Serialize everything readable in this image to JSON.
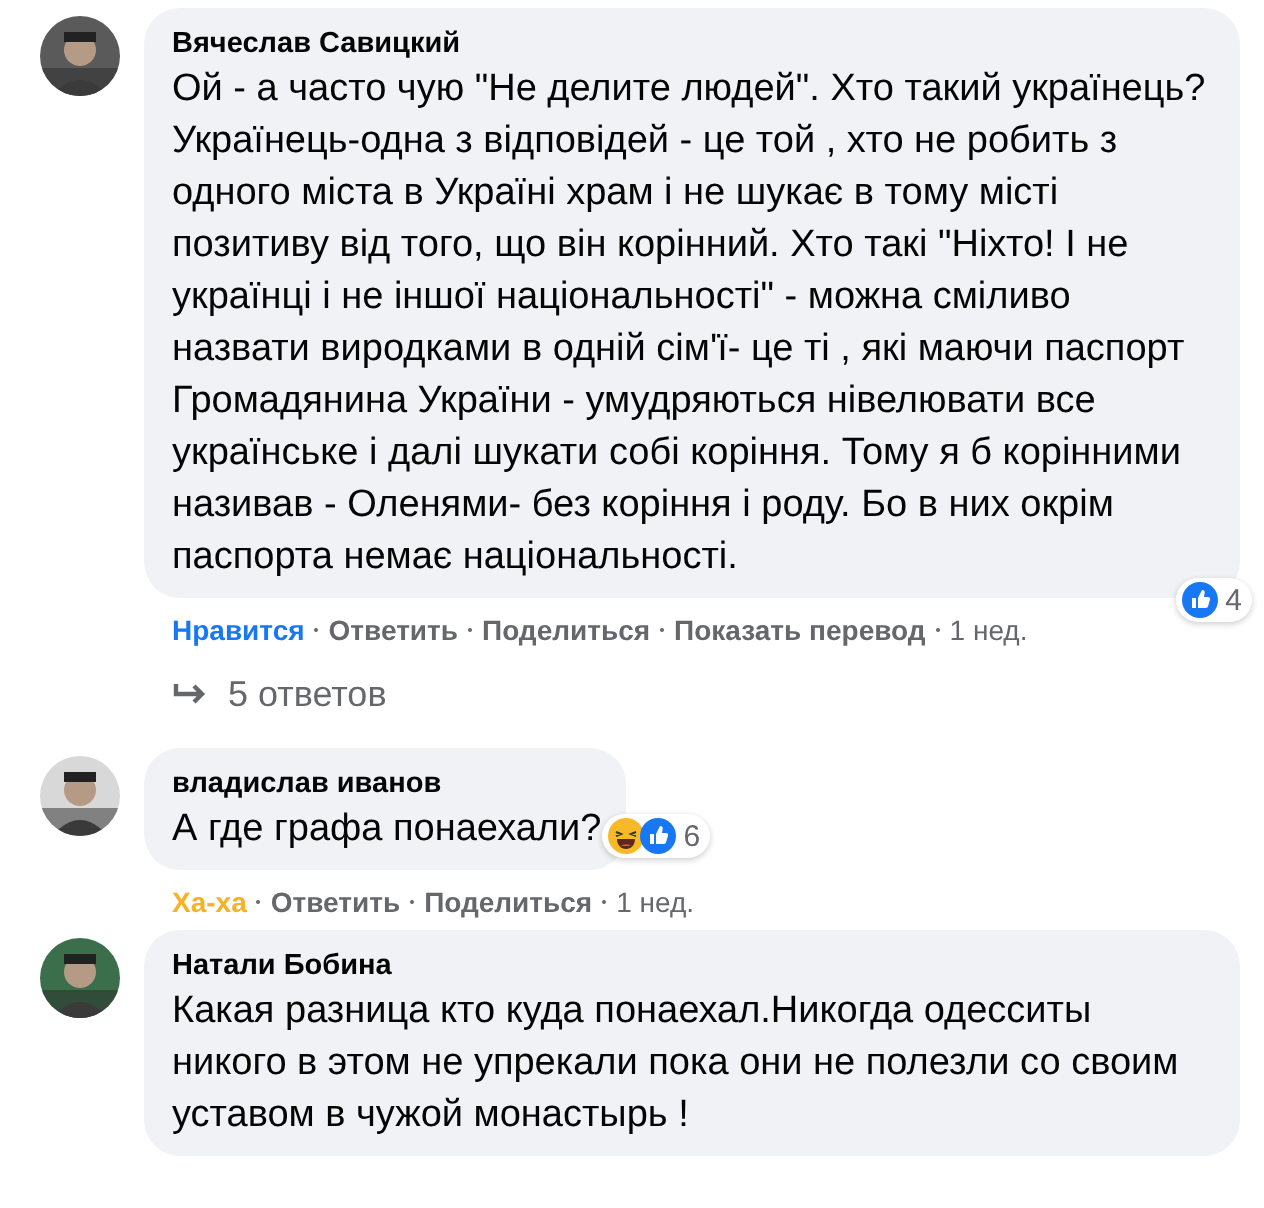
{
  "comments": [
    {
      "author": "Вячеслав Савицкий",
      "text": "Ой - а часто чую \"Не делите людей\". Хто такий українець? Українець-одна з відповідей - це той , хто не робить з одного міста в Україні храм і не шукає в тому місті позитиву від того, що він корінний. Хто такі \"Ніхто! І не українці і не іншої національності\" - можна сміливо назвати виродками в одній сім'ї- це ті , які маючи паспорт Громадянина України - умудряються нівелювати все українське і далі шукати собі коріння. Тому я б корінними називав - Оленями- без коріння і роду. Бо в них окрім паспорта немає національності.",
      "reactions": {
        "icons": [
          {
            "kind": "like"
          }
        ],
        "count": "4"
      },
      "actions": [
        {
          "label": "Нравится",
          "color": "#1877f2"
        },
        {
          "label": "Ответить",
          "color": "#65676b"
        },
        {
          "label": "Поделиться",
          "color": "#65676b"
        },
        {
          "label": "Показать перевод",
          "color": "#65676b"
        }
      ],
      "time": "1 нед.",
      "replies": "5 ответов"
    },
    {
      "author": "владислав иванов",
      "text": "А где графа понаехали?",
      "reactions": {
        "icons": [
          {
            "kind": "haha"
          },
          {
            "kind": "like"
          }
        ],
        "count": "6"
      },
      "actions": [
        {
          "label": "Ха-ха",
          "color": "#f7b125"
        },
        {
          "label": "Ответить",
          "color": "#65676b"
        },
        {
          "label": "Поделиться",
          "color": "#65676b"
        }
      ],
      "time": "1 нед."
    },
    {
      "author": "Натали Бобина",
      "text": "Какая разница кто куда понаехал.Никогда одесситы никого в этом не упрекали пока они не полезли со своим уставом в чужой монастырь !"
    }
  ]
}
